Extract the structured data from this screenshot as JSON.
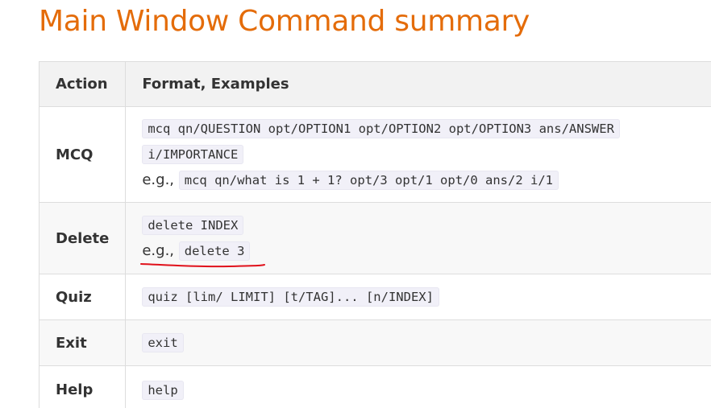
{
  "heading": "Main Window Command summary",
  "table": {
    "headers": [
      "Action",
      "Format, Examples"
    ],
    "rows": [
      {
        "action": "MCQ",
        "format": "mcq qn/QUESTION opt/OPTION1 opt/OPTION2 opt/OPTION3 ans/ANSWER",
        "format_cont": "i/IMPORTANCE",
        "example_prefix": "e.g.,",
        "example": "mcq qn/what is 1 + 1? opt/3 opt/1 opt/0 ans/2 i/1"
      },
      {
        "action": "Delete",
        "format": "delete INDEX",
        "example_prefix": "e.g.,",
        "example": "delete 3"
      },
      {
        "action": "Quiz",
        "format": "quiz [lim/ LIMIT] [t/TAG]... [n/INDEX]"
      },
      {
        "action": "Exit",
        "format": "exit"
      },
      {
        "action": "Help",
        "format": "help"
      }
    ]
  },
  "annotation_color": "#e0101a"
}
